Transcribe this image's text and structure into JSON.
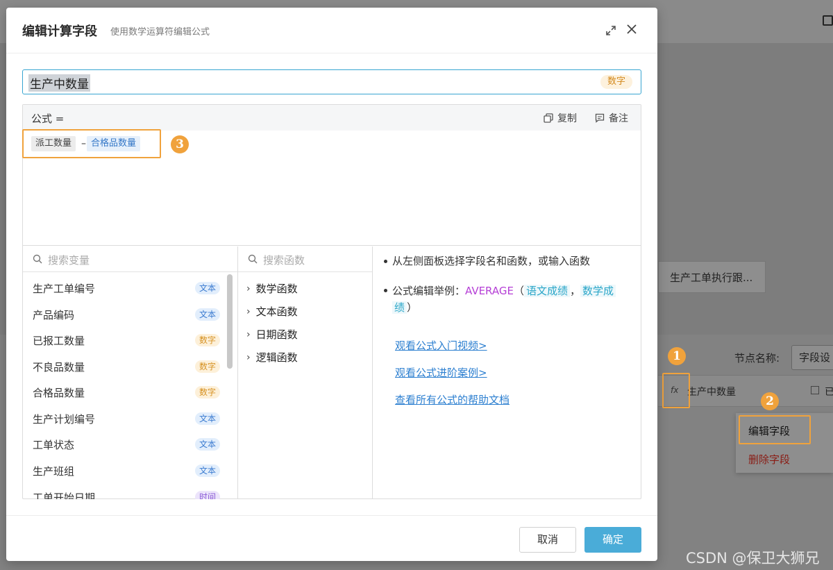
{
  "background": {
    "tab_label": "生产工单执行跟...",
    "node_label": "节点名称:",
    "node_value": "字段设",
    "fx_icon": "fx",
    "column_name": "生产中数量",
    "column_name2": "已",
    "menu": {
      "edit_label": "编辑字段",
      "delete_label": "删除字段"
    }
  },
  "annotations": {
    "num1": "1",
    "num2": "2",
    "num3": "3",
    "color": "#f0a23c"
  },
  "watermark": "CSDN @保卫大狮兄",
  "modal": {
    "title": "编辑计算字段",
    "subtitle": "使用数学运算符编辑公式",
    "field_name": "生产中数量",
    "field_type": "数字",
    "formula": {
      "label": "公式 =",
      "copy_label": "复制",
      "note_label": "备注",
      "tokens": {
        "operand1": "派工数量",
        "operator": "–",
        "operand2": "合格品数量"
      }
    },
    "variables": {
      "search_placeholder": "搜索变量",
      "items": [
        {
          "name": "生产工单编号",
          "type": "文本"
        },
        {
          "name": "产品编码",
          "type": "文本"
        },
        {
          "name": "已报工数量",
          "type": "数字"
        },
        {
          "name": "不良品数量",
          "type": "数字"
        },
        {
          "name": "合格品数量",
          "type": "数字"
        },
        {
          "name": "生产计划编号",
          "type": "文本"
        },
        {
          "name": "工单状态",
          "type": "文本"
        },
        {
          "name": "生产班组",
          "type": "文本"
        },
        {
          "name": "工单开始日期",
          "type": "时间"
        }
      ]
    },
    "functions": {
      "search_placeholder": "搜索函数",
      "categories": [
        "数学函数",
        "文本函数",
        "日期函数",
        "逻辑函数"
      ]
    },
    "help": {
      "line1": "从左侧面板选择字段名和函数，或输入函数",
      "line2_prefix": "公式编辑举例：",
      "line2_fn": "AVERAGE",
      "line2_open": "（",
      "line2_chip1": "语文成绩",
      "line2_sep": "，",
      "line2_chip2_a": "数学成",
      "line2_chip2_b": "绩",
      "line2_close": "）",
      "links": [
        "观看公式入门视频>",
        "观看公式进阶案例>",
        "查看所有公式的帮助文档"
      ]
    },
    "footer": {
      "cancel_label": "取消",
      "ok_label": "确定"
    }
  },
  "colors": {
    "accent": "#4aacd8",
    "focus_border": "#37a5d1",
    "number_tag": "#d69224",
    "text_tag": "#3b7bd0"
  }
}
